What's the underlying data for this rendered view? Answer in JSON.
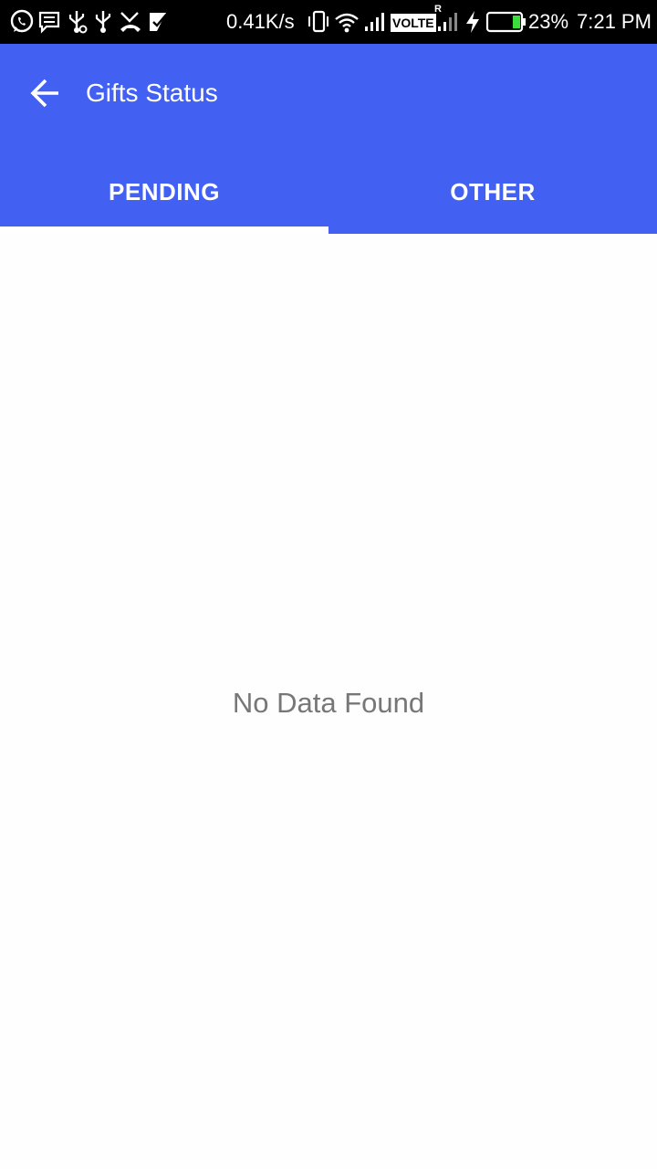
{
  "status_bar": {
    "net_speed": "0.41K/s",
    "volte": "VOLTE",
    "roaming": "R",
    "battery": "23%",
    "time": "7:21 PM",
    "icons": [
      "whatsapp-icon",
      "message-icon",
      "usb-icon",
      "usb-icon",
      "missed-call-icon",
      "check-icon",
      "vibrate-icon",
      "wifi-icon",
      "signal-icon",
      "signal-icon",
      "charging-icon",
      "battery-icon"
    ]
  },
  "app_bar": {
    "title": "Gifts Status",
    "back_icon": "arrow-back-icon"
  },
  "tabs": [
    {
      "label": "PENDING",
      "selected": true
    },
    {
      "label": "OTHER",
      "selected": false
    }
  ],
  "content": {
    "empty_message": "No Data Found"
  },
  "colors": {
    "primary": "#4261f2",
    "status_bar": "#000000",
    "empty_text": "#777777",
    "background": "#fefefe"
  }
}
